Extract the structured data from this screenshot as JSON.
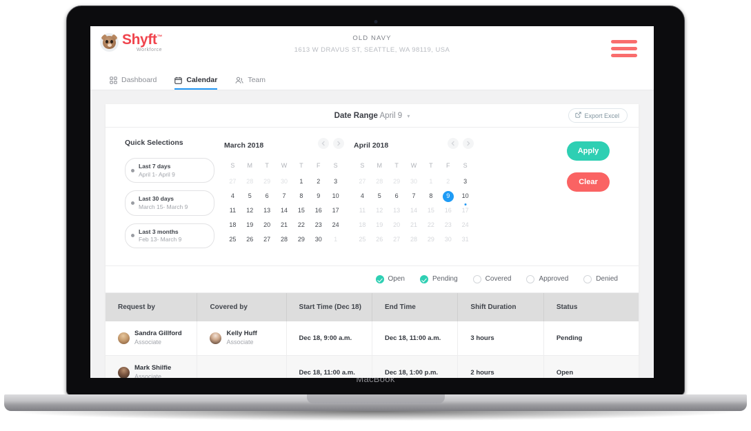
{
  "device": {
    "label": "MacBook"
  },
  "brand": {
    "name": "Shyft",
    "tm": "™",
    "tagline": "Workforce",
    "primary_color": "#f0444d",
    "accent_teal": "#2ecfb3",
    "accent_blue": "#2196f3"
  },
  "header": {
    "store_name": "OLD NAVY",
    "store_address": "1613 W DRAVUS ST, SEATTLE, WA 98119, USA",
    "menu_icon": "hamburger-icon"
  },
  "nav": {
    "tabs": [
      {
        "label": "Dashboard",
        "icon": "grid-icon",
        "active": false
      },
      {
        "label": "Calendar",
        "icon": "calendar-icon",
        "active": true
      },
      {
        "label": "Team",
        "icon": "people-icon",
        "active": false
      }
    ]
  },
  "toolbar": {
    "date_range_label": "Date Range",
    "date_range_value": "April 9",
    "caret": "▾",
    "export_label": "Export Excel",
    "export_icon": "external-link-icon"
  },
  "quick_selections": {
    "title": "Quick Selections",
    "items": [
      {
        "title": "Last 7 days",
        "range": "April 1- April 9"
      },
      {
        "title": "Last 30 days",
        "range": "March 15- March 9"
      },
      {
        "title": "Last 3 months",
        "range": "Feb 13- March 9"
      }
    ]
  },
  "calendars": {
    "dow": [
      "S",
      "M",
      "T",
      "W",
      "T",
      "F",
      "S"
    ],
    "prev_icon": "chevron-left-icon",
    "next_icon": "chevron-right-icon",
    "left": {
      "title": "March 2018",
      "weeks": [
        [
          {
            "d": "27",
            "s": "mute"
          },
          {
            "d": "28",
            "s": "mute"
          },
          {
            "d": "29",
            "s": "mute"
          },
          {
            "d": "30",
            "s": "mute"
          },
          {
            "d": "1",
            "s": ""
          },
          {
            "d": "2",
            "s": ""
          },
          {
            "d": "3",
            "s": ""
          }
        ],
        [
          {
            "d": "4",
            "s": ""
          },
          {
            "d": "5",
            "s": ""
          },
          {
            "d": "6",
            "s": ""
          },
          {
            "d": "7",
            "s": ""
          },
          {
            "d": "8",
            "s": ""
          },
          {
            "d": "9",
            "s": ""
          },
          {
            "d": "10",
            "s": ""
          }
        ],
        [
          {
            "d": "11",
            "s": ""
          },
          {
            "d": "12",
            "s": ""
          },
          {
            "d": "13",
            "s": ""
          },
          {
            "d": "14",
            "s": ""
          },
          {
            "d": "15",
            "s": ""
          },
          {
            "d": "16",
            "s": ""
          },
          {
            "d": "17",
            "s": ""
          }
        ],
        [
          {
            "d": "18",
            "s": ""
          },
          {
            "d": "19",
            "s": ""
          },
          {
            "d": "20",
            "s": ""
          },
          {
            "d": "21",
            "s": ""
          },
          {
            "d": "22",
            "s": ""
          },
          {
            "d": "23",
            "s": ""
          },
          {
            "d": "24",
            "s": ""
          }
        ],
        [
          {
            "d": "25",
            "s": ""
          },
          {
            "d": "26",
            "s": ""
          },
          {
            "d": "27",
            "s": ""
          },
          {
            "d": "28",
            "s": ""
          },
          {
            "d": "29",
            "s": ""
          },
          {
            "d": "30",
            "s": ""
          },
          {
            "d": "1",
            "s": "mute"
          }
        ]
      ]
    },
    "right": {
      "title": "April 2018",
      "selected_day": "9",
      "dot_day": "10",
      "weeks": [
        [
          {
            "d": "27",
            "s": "mute"
          },
          {
            "d": "28",
            "s": "mute"
          },
          {
            "d": "29",
            "s": "mute"
          },
          {
            "d": "30",
            "s": "mute"
          },
          {
            "d": "1",
            "s": "mute"
          },
          {
            "d": "2",
            "s": "mute"
          },
          {
            "d": "3",
            "s": ""
          }
        ],
        [
          {
            "d": "4",
            "s": ""
          },
          {
            "d": "5",
            "s": ""
          },
          {
            "d": "6",
            "s": ""
          },
          {
            "d": "7",
            "s": ""
          },
          {
            "d": "8",
            "s": ""
          },
          {
            "d": "9",
            "s": "sel"
          },
          {
            "d": "10",
            "s": "dot"
          }
        ],
        [
          {
            "d": "11",
            "s": "off"
          },
          {
            "d": "12",
            "s": "off"
          },
          {
            "d": "13",
            "s": "off"
          },
          {
            "d": "14",
            "s": "off"
          },
          {
            "d": "15",
            "s": "off"
          },
          {
            "d": "16",
            "s": "off"
          },
          {
            "d": "17",
            "s": "off"
          }
        ],
        [
          {
            "d": "18",
            "s": "off"
          },
          {
            "d": "19",
            "s": "off"
          },
          {
            "d": "20",
            "s": "off"
          },
          {
            "d": "21",
            "s": "off"
          },
          {
            "d": "22",
            "s": "off"
          },
          {
            "d": "23",
            "s": "off"
          },
          {
            "d": "24",
            "s": "off"
          }
        ],
        [
          {
            "d": "25",
            "s": "off"
          },
          {
            "d": "26",
            "s": "off"
          },
          {
            "d": "27",
            "s": "off"
          },
          {
            "d": "28",
            "s": "off"
          },
          {
            "d": "29",
            "s": "off"
          },
          {
            "d": "30",
            "s": "off"
          },
          {
            "d": "31",
            "s": "off"
          }
        ]
      ]
    }
  },
  "actions": {
    "apply_label": "Apply",
    "clear_label": "Clear"
  },
  "status_filters": [
    {
      "label": "Open",
      "checked": true
    },
    {
      "label": "Pending",
      "checked": true
    },
    {
      "label": "Covered",
      "checked": false
    },
    {
      "label": "Approved",
      "checked": false
    },
    {
      "label": "Denied",
      "checked": false
    }
  ],
  "table": {
    "columns": [
      "Request by",
      "Covered by",
      "Start Time (Dec 18)",
      "End Time",
      "Shift Duration",
      "Status"
    ],
    "rows": [
      {
        "request_by": {
          "name": "Sandra Gillford",
          "role": "Associate"
        },
        "covered_by": {
          "name": "Kelly Huff",
          "role": "Associate"
        },
        "start_time": "Dec 18, 9:00 a.m.",
        "end_time": "Dec 18, 11:00 a.m.",
        "duration": "3 hours",
        "status": "Pending"
      },
      {
        "request_by": {
          "name": "Mark Shilfie",
          "role": "Associate"
        },
        "covered_by": null,
        "start_time": "Dec 18, 11:00 a.m.",
        "end_time": "Dec 18, 1:00 p.m.",
        "duration": "2 hours",
        "status": "Open"
      }
    ]
  }
}
